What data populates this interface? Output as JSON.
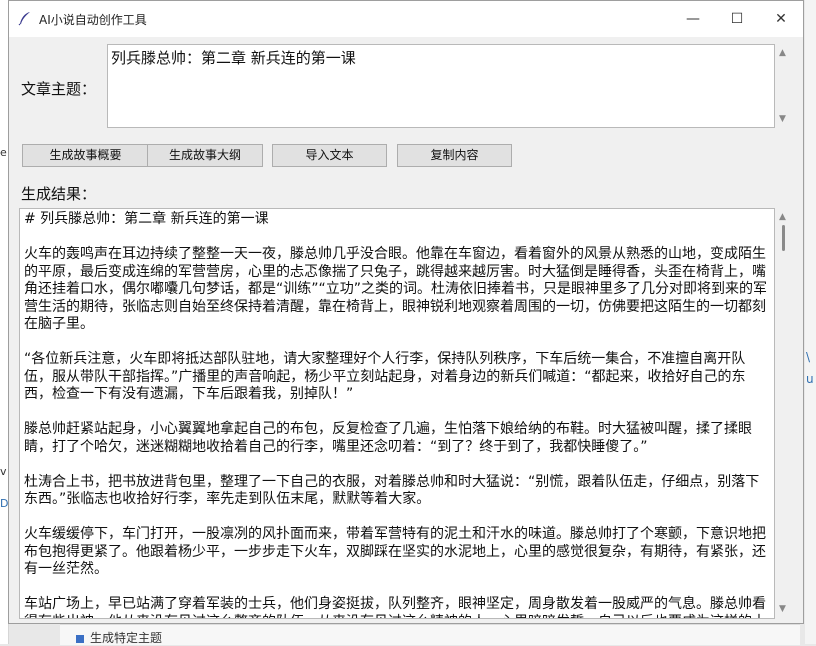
{
  "window": {
    "title": "AI小说自动创作工具",
    "controls": {
      "minimize": "—",
      "maximize": "☐",
      "close": "✕"
    }
  },
  "topic": {
    "label": "文章主题：",
    "value": "列兵滕总帅：第二章 新兵连的第一课"
  },
  "buttons": {
    "summary": "生成故事概要",
    "outline": "生成故事大纲",
    "import": "导入文本",
    "copy": "复制内容"
  },
  "result": {
    "label": "生成结果：",
    "heading": "# 列兵滕总帅：第二章 新兵连的第一课",
    "paragraphs": [
      "火车的轰鸣声在耳边持续了整整一天一夜，滕总帅几乎没合眼。他靠在车窗边，看着窗外的风景从熟悉的山地，变成陌生的平原，最后变成连绵的军营营房，心里的忐忑像揣了只兔子，跳得越来越厉害。时大猛倒是睡得香，头歪在椅背上，嘴角还挂着口水，偶尔嘟囔几句梦话，都是“训练”“立功”之类的词。杜涛依旧捧着书，只是眼神里多了几分对即将到来的军营生活的期待，张临志则自始至终保持着清醒，靠在椅背上，眼神锐利地观察着周围的一切，仿佛要把这陌生的一切都刻在脑子里。",
      "“各位新兵注意，火车即将抵达部队驻地，请大家整理好个人行李，保持队列秩序，下车后统一集合，不准擅自离开队伍，服从带队干部指挥。”广播里的声音响起，杨少平立刻站起身，对着身边的新兵们喊道：“都起来，收拾好自己的东西，检查一下有没有遗漏，下车后跟着我，别掉队！”",
      "滕总帅赶紧站起身，小心翼翼地拿起自己的布包，反复检查了几遍，生怕落下娘给纳的布鞋。时大猛被叫醒，揉了揉眼睛，打了个哈欠，迷迷糊糊地收拾着自己的行李，嘴里还念叨着：“到了？终于到了，我都快睡傻了。”",
      "杜涛合上书，把书放进背包里，整理了一下自己的衣服，对着滕总帅和时大猛说：“别慌，跟着队伍走，仔细点，别落下东西。”张临志也收拾好行李，率先走到队伍末尾，默默等着大家。",
      "火车缓缓停下，车门打开，一股凛冽的风扑面而来，带着军营特有的泥土和汗水的味道。滕总帅打了个寒颤，下意识地把布包抱得更紧了。他跟着杨少平，一步步走下火车，双脚踩在坚实的水泥地上，心里的感觉很复杂，有期待，有紧张，还有一丝茫然。",
      "车站广场上，早已站满了穿着军装的士兵，他们身姿挺拔，队列整齐，眼神坚定，周身散发着一股威严的气息。滕总帅看得有些出神，他从来没有见过这么整齐的队伍，从来没有见过这么精神的人，心里暗暗发誓，自己以后也要成为这样的士兵。"
    ]
  },
  "background": {
    "bottom_item": "生成特定主题",
    "left_glyphs": [
      "e",
      "v",
      "D"
    ],
    "right_marks": [
      "\\",
      "u"
    ]
  }
}
